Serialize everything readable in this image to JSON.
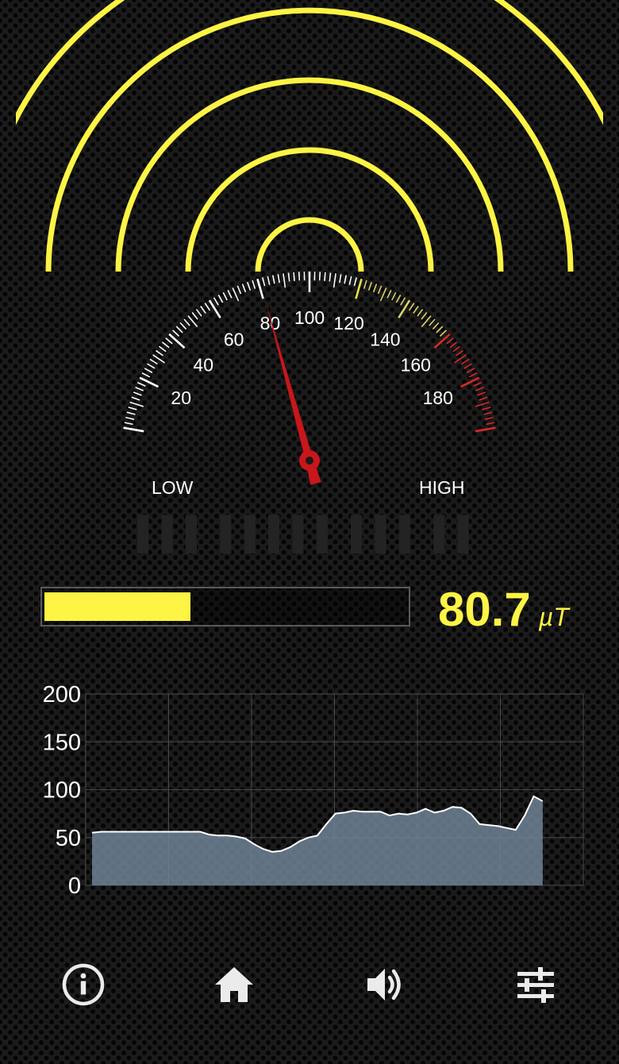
{
  "colors": {
    "accent_yellow": "#fdf445",
    "needle_red": "#c8161b",
    "high_zone_red": "#d62a2a",
    "chart_fill": "#6f8296",
    "chart_line": "#ffffff"
  },
  "gauge": {
    "min": 0,
    "max": 200,
    "value": 80.7,
    "yellow_zone_start": 120,
    "red_zone_start": 160,
    "labels": [
      "20",
      "40",
      "60",
      "80",
      "100",
      "120",
      "140",
      "160",
      "180"
    ],
    "low_label": "LOW",
    "high_label": "HIGH"
  },
  "reading": {
    "value": "80.7",
    "unit": "µT",
    "level_fraction": 0.4035
  },
  "signal_waves": {
    "rings": 5
  },
  "chart_data": {
    "type": "area",
    "y_ticks": [
      "200",
      "150",
      "100",
      "50",
      "0"
    ],
    "ylim": [
      0,
      200
    ],
    "grid": true,
    "x": [
      0,
      2,
      4,
      6,
      8,
      10,
      12,
      14,
      16,
      18,
      20,
      22,
      24,
      26,
      28,
      30,
      32,
      34,
      36,
      38,
      40,
      42,
      44,
      46,
      48,
      50,
      52,
      54,
      56,
      58,
      60,
      62,
      64,
      66,
      68,
      70,
      72,
      74,
      76,
      78,
      80,
      82,
      84,
      86,
      88,
      90,
      92,
      94,
      96,
      98,
      100
    ],
    "y": [
      55,
      56,
      56,
      56,
      56,
      56,
      56,
      56,
      56,
      56,
      56,
      56,
      56,
      53,
      52,
      52,
      51,
      49,
      43,
      38,
      35,
      36,
      40,
      46,
      50,
      52,
      64,
      75,
      76,
      78,
      77,
      77,
      77,
      73,
      75,
      74,
      76,
      80,
      76,
      78,
      82,
      81,
      75,
      64,
      63,
      62,
      60,
      58,
      73,
      93,
      88
    ],
    "x_extent": 109
  },
  "nav": {
    "items": [
      {
        "name": "info",
        "icon": "info-icon"
      },
      {
        "name": "home",
        "icon": "home-icon"
      },
      {
        "name": "sound",
        "icon": "speaker-icon"
      },
      {
        "name": "settings",
        "icon": "sliders-icon"
      }
    ]
  }
}
